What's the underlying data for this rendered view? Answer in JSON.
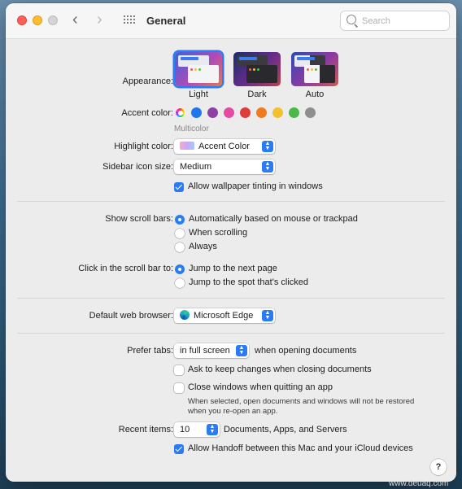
{
  "window": {
    "title": "General"
  },
  "search": {
    "placeholder": "Search"
  },
  "appearance": {
    "label": "Appearance:",
    "options": [
      {
        "label": "Light",
        "selected": true
      },
      {
        "label": "Dark",
        "selected": false
      },
      {
        "label": "Auto",
        "selected": false
      }
    ]
  },
  "accent": {
    "label": "Accent color:",
    "selected_name": "Multicolor",
    "colors": [
      "#8e44ad",
      "#1f77f0",
      "#8f3fa6",
      "#e64aa3",
      "#e23b3b",
      "#f07b1e",
      "#f2c12e",
      "#4cb84a",
      "#8e8e8e"
    ]
  },
  "highlight": {
    "label": "Highlight color:",
    "value": "Accent Color"
  },
  "sidebar_icon": {
    "label": "Sidebar icon size:",
    "value": "Medium"
  },
  "wallpaper_tint": {
    "label": "Allow wallpaper tinting in windows",
    "checked": true
  },
  "scroll_bars": {
    "label": "Show scroll bars:",
    "options": [
      {
        "label": "Automatically based on mouse or trackpad",
        "selected": true
      },
      {
        "label": "When scrolling",
        "selected": false
      },
      {
        "label": "Always",
        "selected": false
      }
    ]
  },
  "scroll_click": {
    "label": "Click in the scroll bar to:",
    "options": [
      {
        "label": "Jump to the next page",
        "selected": true
      },
      {
        "label": "Jump to the spot that's clicked",
        "selected": false
      }
    ]
  },
  "browser": {
    "label": "Default web browser:",
    "value": "Microsoft Edge"
  },
  "tabs": {
    "label": "Prefer tabs:",
    "value": "in full screen",
    "suffix": "when opening documents"
  },
  "keep_changes": {
    "label": "Ask to keep changes when closing documents",
    "checked": false
  },
  "close_windows": {
    "label": "Close windows when quitting an app",
    "checked": false,
    "note_line1": "When selected, open documents and windows will not be restored",
    "note_line2": "when you re-open an app."
  },
  "recent": {
    "label": "Recent items:",
    "value": "10",
    "suffix": "Documents, Apps, and Servers"
  },
  "handoff": {
    "label": "Allow Handoff between this Mac and your iCloud devices",
    "checked": true
  },
  "help": {
    "label": "?"
  },
  "watermark": "www.deuaq.com"
}
